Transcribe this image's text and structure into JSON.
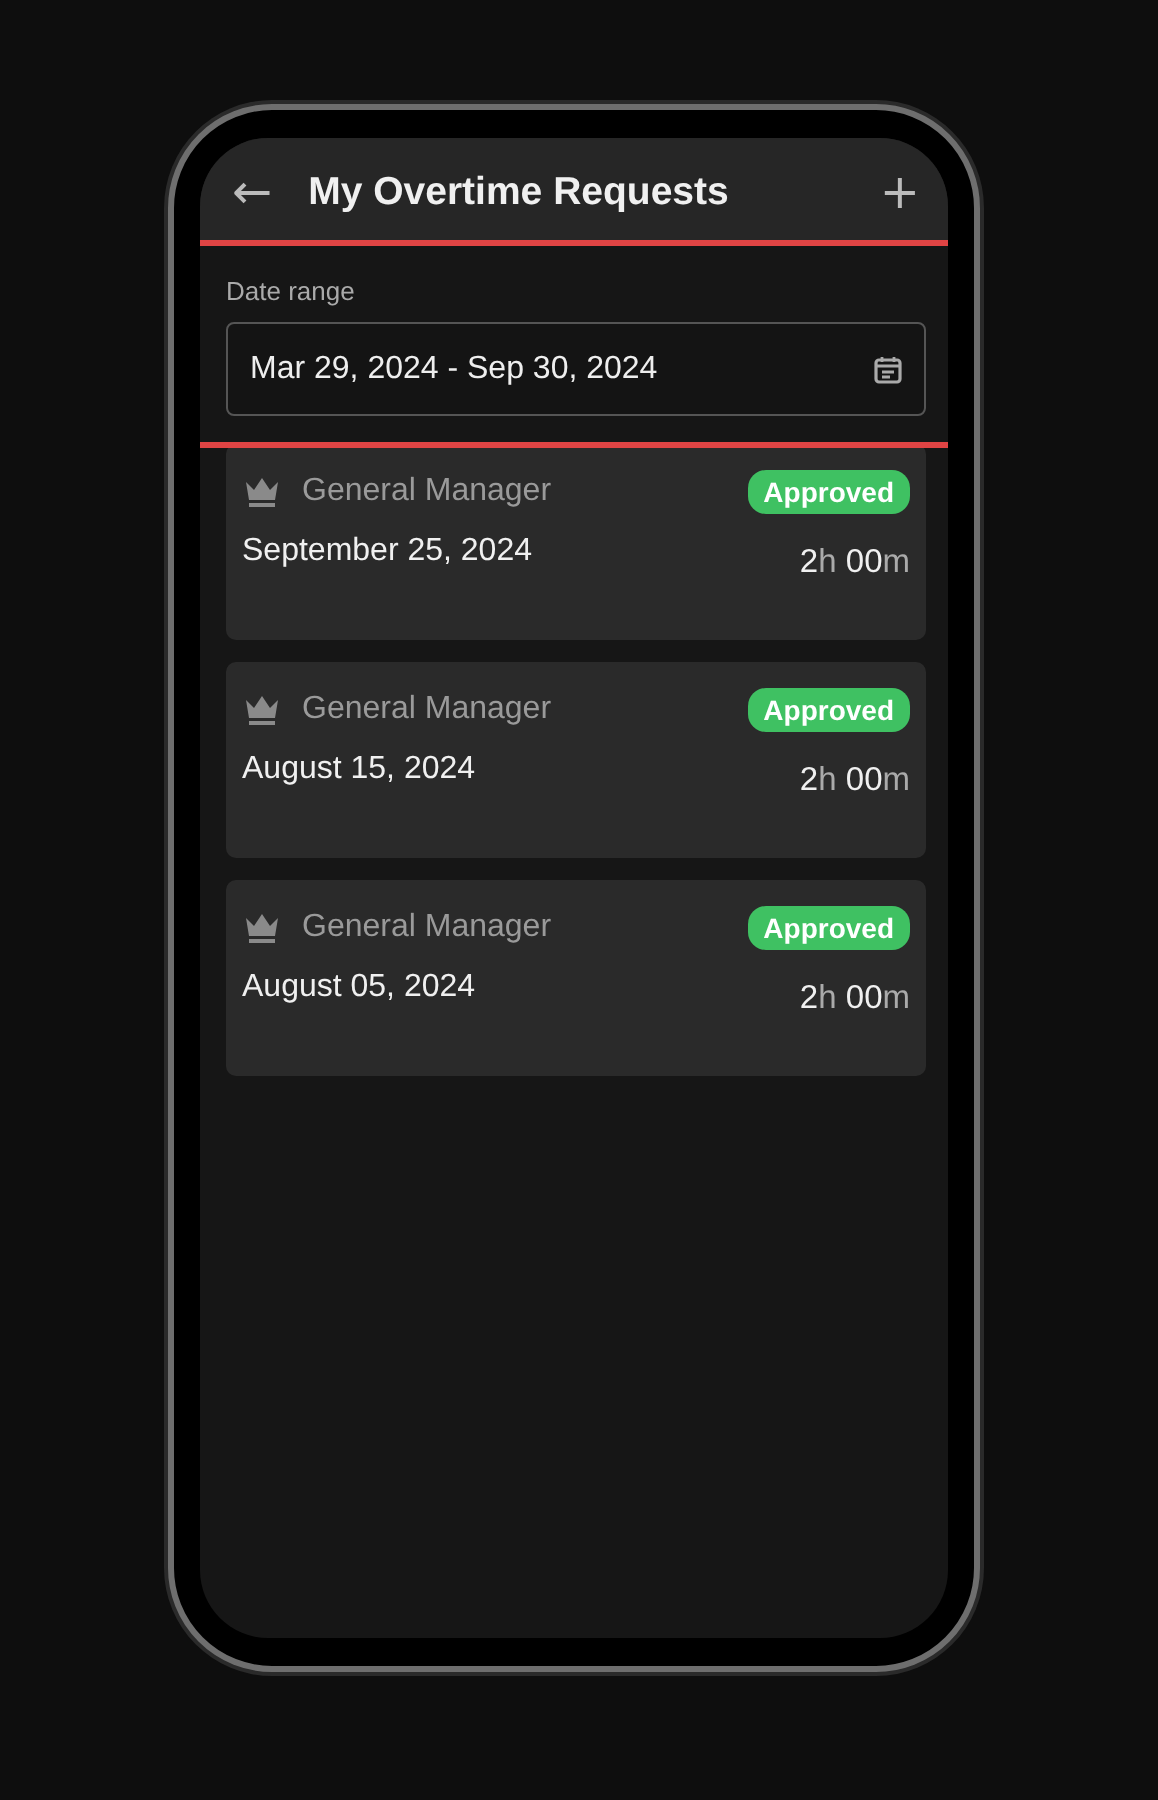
{
  "header": {
    "back_icon": "←",
    "title": "My Overtime Requests",
    "add_icon": "+"
  },
  "date_range": {
    "label": "Date range",
    "value": "Mar 29, 2024 - Sep 30, 2024",
    "highlighted": true
  },
  "requests": [
    {
      "approver": "General Manager",
      "status": "Approved",
      "color": "#3fc162",
      "date": "September 25, 2024",
      "hours": "2",
      "hours_unit": "h",
      "minutes": "00",
      "minutes_unit": "m"
    },
    {
      "approver": "General Manager",
      "status": "Approved",
      "color": "#3fc162",
      "date": "August 15, 2024",
      "hours": "2",
      "hours_unit": "h",
      "minutes": "00",
      "minutes_unit": "m"
    },
    {
      "approver": "General Manager",
      "status": "Approved",
      "color": "#3fc162",
      "date": "August 05, 2024",
      "hours": "2",
      "hours_unit": "h",
      "minutes": "00",
      "minutes_unit": "m"
    }
  ]
}
